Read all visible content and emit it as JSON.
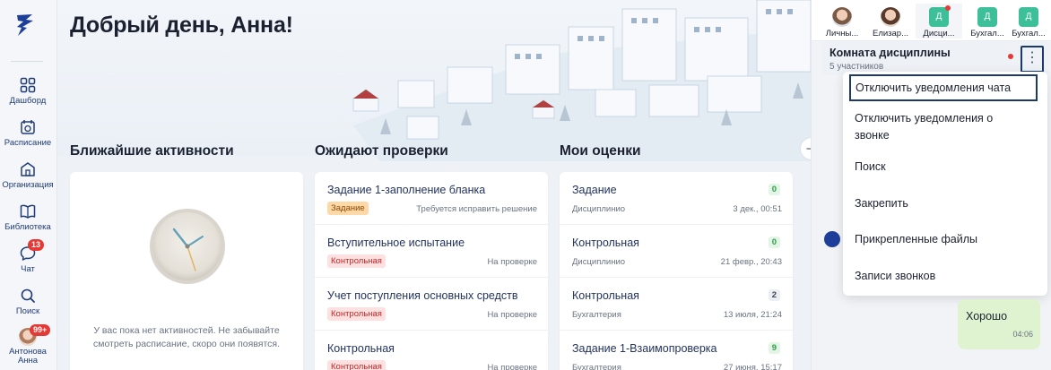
{
  "colors": {
    "accent": "#1f3b78",
    "badge": "#e53935",
    "bubble": "#dff3d0"
  },
  "sidebar": {
    "items": [
      {
        "icon": "dashboard-icon",
        "label": "Дашборд"
      },
      {
        "icon": "calendar-icon",
        "label": "Расписание"
      },
      {
        "icon": "organization-icon",
        "label": "Организация"
      },
      {
        "icon": "library-icon",
        "label": "Библиотека"
      },
      {
        "icon": "chat-icon",
        "label": "Чат",
        "badge": "13"
      },
      {
        "icon": "search-icon",
        "label": "Поиск"
      }
    ],
    "user": {
      "name_line1": "Антонова",
      "name_line2": "Анна",
      "badge": "99+"
    }
  },
  "main": {
    "greeting": "Добрый день, Анна!",
    "activities": {
      "title": "Ближайшие активности",
      "empty_text": "У вас пока нет активностей. Не забывайте смотреть расписание, скоро они появятся."
    },
    "review": {
      "title": "Ожидают проверки",
      "items": [
        {
          "title": "Задание 1-заполнение бланка",
          "tag": "Задание",
          "tag_color": "orange",
          "status": "Требуется исправить решение"
        },
        {
          "title": "Вступительное испытание",
          "tag": "Контрольная",
          "tag_color": "red",
          "status": "На проверке"
        },
        {
          "title": "Учет поступления основных средств",
          "tag": "Контрольная",
          "tag_color": "red",
          "status": "На проверке"
        },
        {
          "title": "Контрольная",
          "tag": "Контрольная",
          "tag_color": "red",
          "status": "На проверке"
        }
      ]
    },
    "grades": {
      "title": "Мои оценки",
      "items": [
        {
          "title": "Задание",
          "score": "0",
          "score_color": "green",
          "subject": "Дисциплинио",
          "date": "3 дек., 00:51"
        },
        {
          "title": "Контрольная",
          "score": "0",
          "score_color": "green",
          "subject": "Дисциплинио",
          "date": "21 февр., 20:43"
        },
        {
          "title": "Контрольная",
          "score": "2",
          "score_color": "grey",
          "subject": "Бухгалтерия",
          "date": "13 июля, 21:24"
        },
        {
          "title": "Задание 1-Взаимопроверка",
          "score": "9",
          "score_color": "green",
          "subject": "Бухгалтерия",
          "date": "27 июня, 15:17"
        }
      ]
    }
  },
  "chat": {
    "tabs": [
      {
        "label": "Личны...",
        "avatar": "photo",
        "unread": false
      },
      {
        "label": "Елизар...",
        "avatar": "photo",
        "unread": false
      },
      {
        "label": "Дисци...",
        "avatar": "Д",
        "unread": true
      },
      {
        "label": "Бухгал...",
        "avatar": "Д",
        "unread": false
      },
      {
        "label": "Бухгал...",
        "avatar": "Д",
        "unread": false
      }
    ],
    "room": {
      "title": "Комната дисциплины",
      "subtitle": "5 участников"
    },
    "menu": [
      "Отключить уведомления чата",
      "Отключить уведомления о звонке",
      "Поиск",
      "Закрепить",
      "Прикрепленные файлы",
      "Записи звонков"
    ],
    "message": {
      "text": "Хорошо",
      "time": "04:06"
    }
  }
}
